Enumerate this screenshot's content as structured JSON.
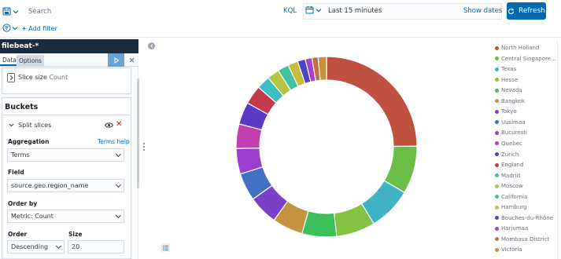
{
  "search": {
    "placeholder": "Search",
    "language": "KQL"
  },
  "time": {
    "range": "Last 15 minutes",
    "show_dates": "Show dates",
    "refresh": "Refresh"
  },
  "filters": {
    "add_label": "+ Add filter"
  },
  "sidebar": {
    "index_pattern": "filebeat-*",
    "tabs": [
      {
        "label": "Data"
      },
      {
        "label": "Options"
      }
    ],
    "metric": {
      "label": "Slice size",
      "value": "Count"
    },
    "buckets": {
      "title": "Buckets",
      "split_label": "Split slices",
      "aggregation_label": "Aggregation",
      "aggregation_help": "Terms help",
      "aggregation_value": "Terms",
      "field_label": "Field",
      "field_value": "source.geo.region_name",
      "order_by_label": "Order by",
      "order_by_value": "Metric: Count",
      "order_label": "Order",
      "order_value": "Descending",
      "size_label": "Size",
      "size_value": "20"
    }
  },
  "chart_data": {
    "type": "pie",
    "donut": true,
    "legend_position": "right",
    "slices": [
      {
        "label": "North Holland",
        "value": 25.0,
        "color": "#c0513f"
      },
      {
        "label": "Central Singapore...",
        "value": 8.6,
        "color": "#6cbd45"
      },
      {
        "label": "Texas",
        "value": 7.8,
        "color": "#3fb3c3"
      },
      {
        "label": "Hesse",
        "value": 7.0,
        "color": "#82c341"
      },
      {
        "label": "Nevada",
        "value": 6.2,
        "color": "#3cc05b"
      },
      {
        "label": "Bangkok",
        "value": 5.5,
        "color": "#c4933e"
      },
      {
        "label": "Tokyo",
        "value": 5.3,
        "color": "#7a40c7"
      },
      {
        "label": "Uusimaa",
        "value": 5.0,
        "color": "#4170c3"
      },
      {
        "label": "Bucuresti",
        "value": 4.6,
        "color": "#9c3ed0"
      },
      {
        "label": "Quebec",
        "value": 4.4,
        "color": "#c23fb2"
      },
      {
        "label": "Zurich",
        "value": 4.0,
        "color": "#5a39c6"
      },
      {
        "label": "England",
        "value": 3.4,
        "color": "#c33a4a"
      },
      {
        "label": "Madrid",
        "value": 2.4,
        "color": "#3cbec1"
      },
      {
        "label": "Moscow",
        "value": 2.2,
        "color": "#b7c53e"
      },
      {
        "label": "California",
        "value": 2.0,
        "color": "#43c2a0"
      },
      {
        "label": "Hamburg",
        "value": 1.8,
        "color": "#c6bd3f"
      },
      {
        "label": "Bouches-du-Rhône",
        "value": 1.4,
        "color": "#4b45c4"
      },
      {
        "label": "Harjumaa",
        "value": 1.2,
        "color": "#a63fc9"
      },
      {
        "label": "Mombasa District",
        "value": 1.1,
        "color": "#c66f3d"
      },
      {
        "label": "Victoria",
        "value": 1.5,
        "color": "#c5943a"
      }
    ]
  }
}
